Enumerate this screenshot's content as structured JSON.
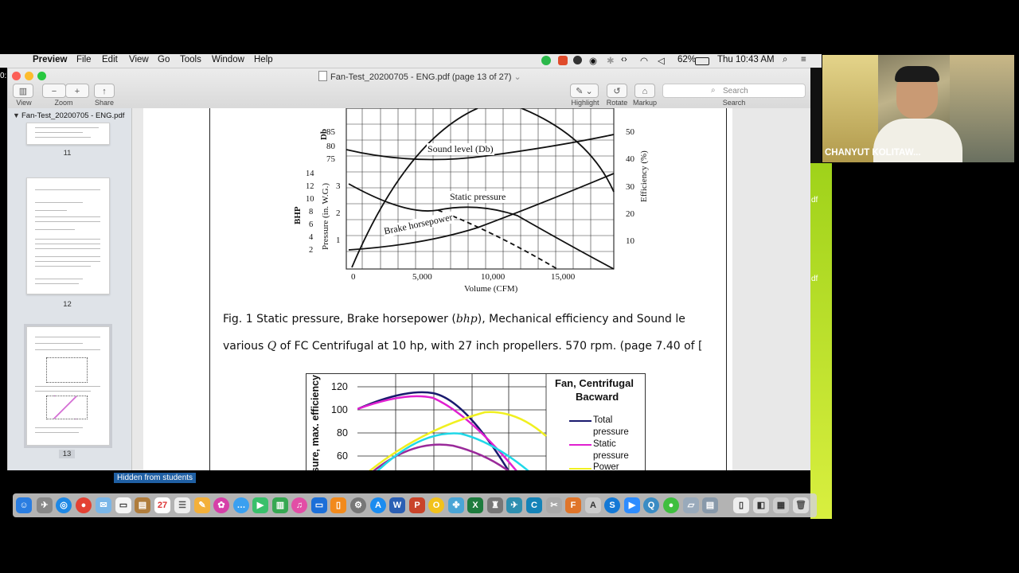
{
  "menubar": {
    "app": "Preview",
    "items": [
      "File",
      "Edit",
      "View",
      "Go",
      "Tools",
      "Window",
      "Help"
    ],
    "battery": "62%",
    "clock": "Thu 10:43 AM"
  },
  "window": {
    "title": "Fan-Test_20200705 - ENG.pdf (page 13 of 27)",
    "toolbar": {
      "view": "View",
      "zoom": "Zoom",
      "share": "Share",
      "highlight": "Highlight",
      "rotate": "Rotate",
      "markup": "Markup",
      "search_label": "Search",
      "search_placeholder": "Search"
    },
    "sidebar": {
      "doc_name": "Fan-Test_20200705 - ENG.pdf",
      "pages": [
        "11",
        "12",
        "13"
      ]
    }
  },
  "document": {
    "figure1": {
      "db_label": "Db",
      "db_ticks": [
        "85",
        "80",
        "75"
      ],
      "bhp_label": "BHP",
      "bhp_ticks": [
        "14",
        "12",
        "10",
        "8",
        "6",
        "4",
        "2"
      ],
      "pressure_label": "Pressure (in. W.G.)",
      "pressure_ticks": [
        "3",
        "2",
        "1"
      ],
      "efficiency_label": "Efficiency (%)",
      "efficiency_ticks": [
        "50",
        "40",
        "30",
        "20",
        "10"
      ],
      "x_ticks": [
        "0",
        "5,000",
        "10,000",
        "15,000"
      ],
      "x_label": "Volume (CFM)",
      "curve_sound": "Sound level (Db)",
      "curve_static": "Static pressure",
      "curve_brake": "Brake horsepower"
    },
    "caption_line1_a": "Fig. 1 Static pressure, Brake horsepower (",
    "caption_bhp": "bhp",
    "caption_line1_b": "), Mechanical efficiency and Sound le",
    "caption_line2_a": "various ",
    "caption_q": "Q",
    "caption_line2_b": " of FC Centrifugal at 10 hp, with 27 inch propellers. 570 rpm. (page 7.40 of [",
    "figure2": {
      "title_line1": "Fan, Centrifugal",
      "title_line2": "Bacward",
      "y_ticks": [
        "120",
        "100",
        "80",
        "60"
      ],
      "y_label": "sure, max. efficiency",
      "legend": [
        {
          "label_a": "Total",
          "label_b": "pressure",
          "color": "#1a1a6e"
        },
        {
          "label_a": "Static",
          "label_b": "pressure",
          "color": "#e020d0"
        },
        {
          "label_a": "Power",
          "label_b": "",
          "color": "#f0f020"
        }
      ]
    }
  },
  "desktop": {
    "labels": [
      "df",
      "df"
    ],
    "hidden_badge": "Hidden from students",
    "left_edge": "0:"
  },
  "webcam": {
    "name": "CHANYUT KOLITAW..."
  },
  "colors": {
    "accent": "#1f5fa3",
    "green_desktop": "#c7e62f"
  }
}
